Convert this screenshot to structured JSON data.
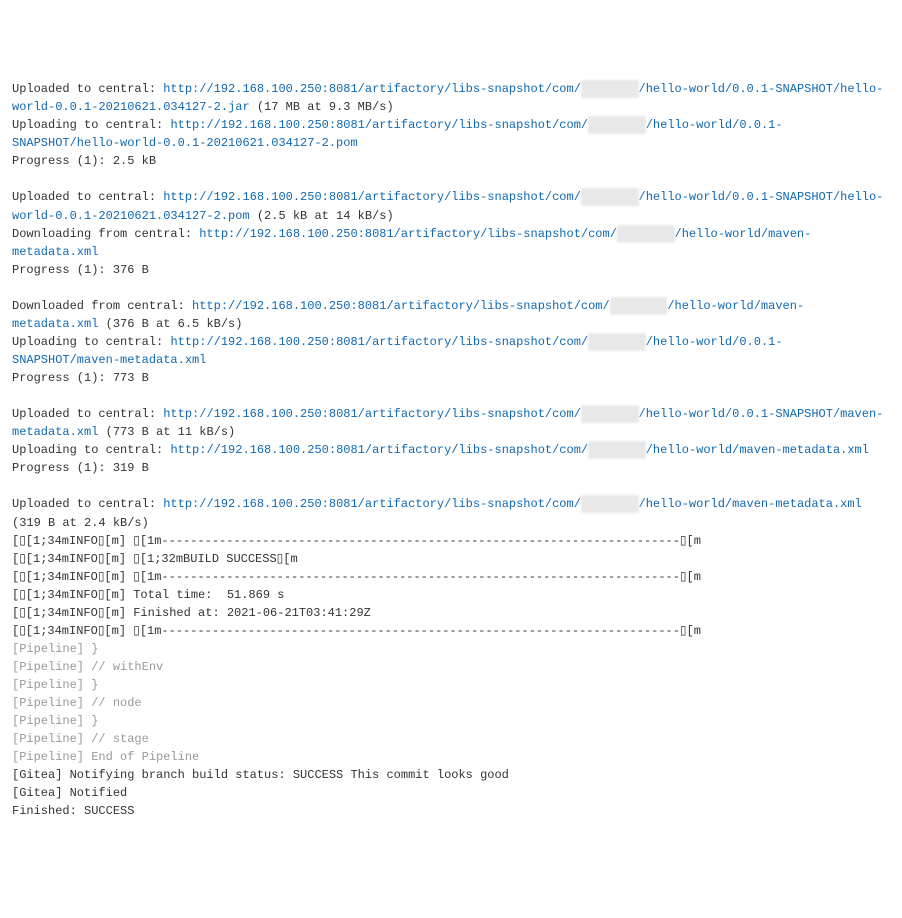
{
  "lines": [
    {
      "parts": [
        {
          "t": "plain",
          "v": "Uploaded to central: "
        },
        {
          "t": "link",
          "v": "http://192.168.100.250:8081/artifactory/libs-snapshot/com/"
        },
        {
          "t": "redacted",
          "v": "xxxxxxxx"
        },
        {
          "t": "link",
          "v": "/hello-world/0.0.1-SNAPSHOT/hello-world-0.0.1-20210621.034127-2.jar"
        },
        {
          "t": "plain",
          "v": " (17 MB at 9.3 MB/s)"
        }
      ]
    },
    {
      "parts": [
        {
          "t": "plain",
          "v": "Uploading to central: "
        },
        {
          "t": "link",
          "v": "http://192.168.100.250:8081/artifactory/libs-snapshot/com/"
        },
        {
          "t": "redacted",
          "v": "xxxxxxxx"
        },
        {
          "t": "link",
          "v": "/hello-world/0.0.1-SNAPSHOT/hello-world-0.0.1-20210621.034127-2.pom"
        }
      ]
    },
    {
      "parts": [
        {
          "t": "plain",
          "v": "Progress (1): 2.5 kB"
        }
      ]
    },
    {
      "parts": [
        {
          "t": "plain",
          "v": " "
        }
      ]
    },
    {
      "parts": [
        {
          "t": "plain",
          "v": "Uploaded to central: "
        },
        {
          "t": "link",
          "v": "http://192.168.100.250:8081/artifactory/libs-snapshot/com/"
        },
        {
          "t": "redacted",
          "v": "xxxxxxxx"
        },
        {
          "t": "link",
          "v": "/hello-world/0.0.1-SNAPSHOT/hello-world-0.0.1-20210621.034127-2.pom"
        },
        {
          "t": "plain",
          "v": " (2.5 kB at 14 kB/s)"
        }
      ]
    },
    {
      "parts": [
        {
          "t": "plain",
          "v": "Downloading from central: "
        },
        {
          "t": "link",
          "v": "http://192.168.100.250:8081/artifactory/libs-snapshot/com/"
        },
        {
          "t": "redacted",
          "v": "xxxxxxxx"
        },
        {
          "t": "link",
          "v": "/hello-world/maven-metadata.xml"
        }
      ]
    },
    {
      "parts": [
        {
          "t": "plain",
          "v": "Progress (1): 376 B"
        }
      ]
    },
    {
      "parts": [
        {
          "t": "plain",
          "v": " "
        }
      ]
    },
    {
      "parts": [
        {
          "t": "plain",
          "v": "Downloaded from central: "
        },
        {
          "t": "link",
          "v": "http://192.168.100.250:8081/artifactory/libs-snapshot/com/"
        },
        {
          "t": "redacted",
          "v": "xxxxxxxx"
        },
        {
          "t": "link",
          "v": "/hello-world/maven-metadata.xml"
        },
        {
          "t": "plain",
          "v": " (376 B at 6.5 kB/s)"
        }
      ]
    },
    {
      "parts": [
        {
          "t": "plain",
          "v": "Uploading to central: "
        },
        {
          "t": "link",
          "v": "http://192.168.100.250:8081/artifactory/libs-snapshot/com/"
        },
        {
          "t": "redacted",
          "v": "xxxxxxxx"
        },
        {
          "t": "link",
          "v": "/hello-world/0.0.1-SNAPSHOT/maven-metadata.xml"
        }
      ]
    },
    {
      "parts": [
        {
          "t": "plain",
          "v": "Progress (1): 773 B"
        }
      ]
    },
    {
      "parts": [
        {
          "t": "plain",
          "v": " "
        }
      ]
    },
    {
      "parts": [
        {
          "t": "plain",
          "v": "Uploaded to central: "
        },
        {
          "t": "link",
          "v": "http://192.168.100.250:8081/artifactory/libs-snapshot/com/"
        },
        {
          "t": "redacted",
          "v": "xxxxxxxx"
        },
        {
          "t": "link",
          "v": "/hello-world/0.0.1-SNAPSHOT/maven-metadata.xml"
        },
        {
          "t": "plain",
          "v": " (773 B at 11 kB/s)"
        }
      ]
    },
    {
      "parts": [
        {
          "t": "plain",
          "v": "Uploading to central: "
        },
        {
          "t": "link",
          "v": "http://192.168.100.250:8081/artifactory/libs-snapshot/com/"
        },
        {
          "t": "redacted",
          "v": "xxxxxxxx"
        },
        {
          "t": "link",
          "v": "/hello-world/maven-metadata.xml"
        }
      ]
    },
    {
      "parts": [
        {
          "t": "plain",
          "v": "Progress (1): 319 B"
        }
      ]
    },
    {
      "parts": [
        {
          "t": "plain",
          "v": " "
        }
      ]
    },
    {
      "parts": [
        {
          "t": "plain",
          "v": "Uploaded to central: "
        },
        {
          "t": "link",
          "v": "http://192.168.100.250:8081/artifactory/libs-snapshot/com/"
        },
        {
          "t": "redacted",
          "v": "xxxxxxxx"
        },
        {
          "t": "link",
          "v": "/hello-world/maven-metadata.xml"
        },
        {
          "t": "plain",
          "v": " (319 B at 2.4 kB/s)"
        }
      ]
    },
    {
      "parts": [
        {
          "t": "plain",
          "v": "\u001b[1;34mINFO\u001b[m] \u001b[1m------------------------------------------------------------------------\u001b[m"
        }
      ]
    },
    {
      "parts": [
        {
          "t": "plain",
          "v": "\u001b[1;34mINFO\u001b[m] \u001b[1;32mBUILD SUCCESS\u001b[m"
        }
      ]
    },
    {
      "parts": [
        {
          "t": "plain",
          "v": "\u001b[1;34mINFO\u001b[m] \u001b[1m------------------------------------------------------------------------\u001b[m"
        }
      ]
    },
    {
      "parts": [
        {
          "t": "plain",
          "v": "\u001b[1;34mINFO\u001b[m] Total time:  51.869 s"
        }
      ]
    },
    {
      "parts": [
        {
          "t": "plain",
          "v": "\u001b[1;34mINFO\u001b[m] Finished at: 2021-06-21T03:41:29Z"
        }
      ]
    },
    {
      "parts": [
        {
          "t": "plain",
          "v": "\u001b[1;34mINFO\u001b[m] \u001b[1m------------------------------------------------------------------------\u001b[m"
        }
      ]
    },
    {
      "parts": [
        {
          "t": "gray",
          "v": "[Pipeline] }"
        }
      ]
    },
    {
      "parts": [
        {
          "t": "gray",
          "v": "[Pipeline] // withEnv"
        }
      ]
    },
    {
      "parts": [
        {
          "t": "gray",
          "v": "[Pipeline] }"
        }
      ]
    },
    {
      "parts": [
        {
          "t": "gray",
          "v": "[Pipeline] // node"
        }
      ]
    },
    {
      "parts": [
        {
          "t": "gray",
          "v": "[Pipeline] }"
        }
      ]
    },
    {
      "parts": [
        {
          "t": "gray",
          "v": "[Pipeline] // stage"
        }
      ]
    },
    {
      "parts": [
        {
          "t": "gray",
          "v": "[Pipeline] End of Pipeline"
        }
      ]
    },
    {
      "parts": [
        {
          "t": "plain",
          "v": "[Gitea] Notifying branch build status: SUCCESS This commit looks good"
        }
      ]
    },
    {
      "parts": [
        {
          "t": "plain",
          "v": "[Gitea] Notified"
        }
      ]
    },
    {
      "parts": [
        {
          "t": "plain",
          "v": "Finished: SUCCESS"
        }
      ]
    }
  ],
  "esc_symbol": "\u001b"
}
